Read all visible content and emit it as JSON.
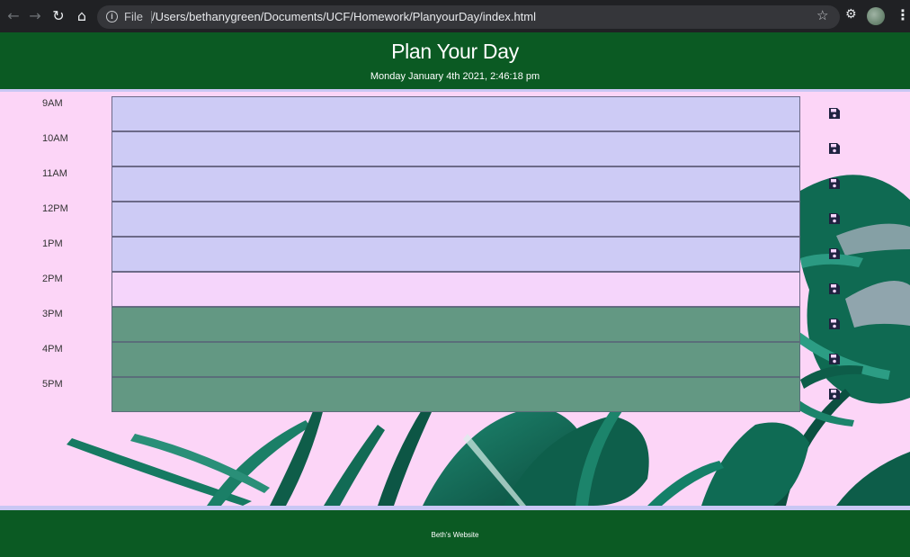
{
  "browser": {
    "scheme_label": "File",
    "url": "/Users/bethanygreen/Documents/UCF/Homework/PlanyourDay/index.html"
  },
  "header": {
    "title": "Plan Your Day",
    "datetime": "Monday January 4th 2021, 2:46:18 pm"
  },
  "hours": [
    {
      "label": "9AM",
      "state": "past"
    },
    {
      "label": "10AM",
      "state": "past"
    },
    {
      "label": "11AM",
      "state": "past"
    },
    {
      "label": "12PM",
      "state": "past"
    },
    {
      "label": "1PM",
      "state": "past"
    },
    {
      "label": "2PM",
      "state": "present"
    },
    {
      "label": "3PM",
      "state": "future"
    },
    {
      "label": "4PM",
      "state": "future"
    },
    {
      "label": "5PM",
      "state": "future"
    }
  ],
  "footer": {
    "text": "Beth's Website"
  },
  "colors": {
    "header_bg": "#0b5a23",
    "past": "#cdcbf5",
    "present": "#f5d5fb",
    "future": "#639883",
    "page_bg": "#fcd5f7"
  }
}
